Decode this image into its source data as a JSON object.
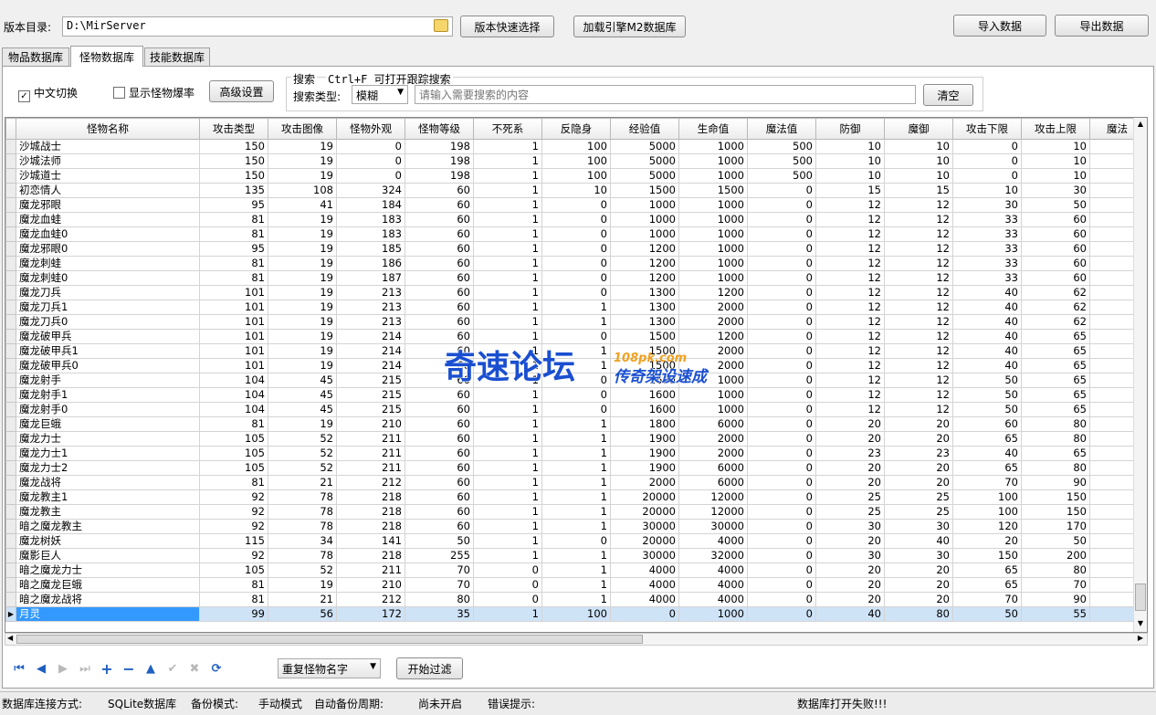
{
  "toolbar": {
    "dir_label": "版本目录:",
    "dir_value": "D:\\MirServer",
    "quick_select": "版本快速选择",
    "load_db": "加载引擎M2数据库",
    "import": "导入数据",
    "export": "导出数据"
  },
  "tabs": [
    "物品数据库",
    "怪物数据库",
    "技能数据库"
  ],
  "options": {
    "chinese_toggle": "中文切换",
    "show_drops": "显示怪物爆率",
    "advanced": "高级设置"
  },
  "search": {
    "title": "搜索",
    "hint": "Ctrl+F 可打开跟踪搜索",
    "type_label": "搜索类型:",
    "type_value": "模糊",
    "placeholder": "请输入需要搜索的内容",
    "clear": "清空"
  },
  "grid": {
    "columns": [
      "怪物名称",
      "攻击类型",
      "攻击图像",
      "怪物外观",
      "怪物等级",
      "不死系",
      "反隐身",
      "经验值",
      "生命值",
      "魔法值",
      "防御",
      "魔御",
      "攻击下限",
      "攻击上限",
      "魔法"
    ],
    "rows": [
      [
        "沙城战士",
        "150",
        "19",
        "0",
        "198",
        "1",
        "100",
        "5000",
        "1000",
        "500",
        "10",
        "10",
        "0",
        "10"
      ],
      [
        "沙城法师",
        "150",
        "19",
        "0",
        "198",
        "1",
        "100",
        "5000",
        "1000",
        "500",
        "10",
        "10",
        "0",
        "10"
      ],
      [
        "沙城道士",
        "150",
        "19",
        "0",
        "198",
        "1",
        "100",
        "5000",
        "1000",
        "500",
        "10",
        "10",
        "0",
        "10"
      ],
      [
        "初恋情人",
        "135",
        "108",
        "324",
        "60",
        "1",
        "10",
        "1500",
        "1500",
        "0",
        "15",
        "15",
        "10",
        "30"
      ],
      [
        "魔龙邪眼",
        "95",
        "41",
        "184",
        "60",
        "1",
        "0",
        "1000",
        "1000",
        "0",
        "12",
        "12",
        "30",
        "50"
      ],
      [
        "魔龙血蛙",
        "81",
        "19",
        "183",
        "60",
        "1",
        "0",
        "1000",
        "1000",
        "0",
        "12",
        "12",
        "33",
        "60"
      ],
      [
        "魔龙血蛙0",
        "81",
        "19",
        "183",
        "60",
        "1",
        "0",
        "1000",
        "1000",
        "0",
        "12",
        "12",
        "33",
        "60"
      ],
      [
        "魔龙邪眼0",
        "95",
        "19",
        "185",
        "60",
        "1",
        "0",
        "1200",
        "1000",
        "0",
        "12",
        "12",
        "33",
        "60"
      ],
      [
        "魔龙刺蛙",
        "81",
        "19",
        "186",
        "60",
        "1",
        "0",
        "1200",
        "1000",
        "0",
        "12",
        "12",
        "33",
        "60"
      ],
      [
        "魔龙刺蛙0",
        "81",
        "19",
        "187",
        "60",
        "1",
        "0",
        "1200",
        "1000",
        "0",
        "12",
        "12",
        "33",
        "60"
      ],
      [
        "魔龙刀兵",
        "101",
        "19",
        "213",
        "60",
        "1",
        "0",
        "1300",
        "1200",
        "0",
        "12",
        "12",
        "40",
        "62"
      ],
      [
        "魔龙刀兵1",
        "101",
        "19",
        "213",
        "60",
        "1",
        "1",
        "1300",
        "2000",
        "0",
        "12",
        "12",
        "40",
        "62"
      ],
      [
        "魔龙刀兵0",
        "101",
        "19",
        "213",
        "60",
        "1",
        "1",
        "1300",
        "2000",
        "0",
        "12",
        "12",
        "40",
        "62"
      ],
      [
        "魔龙破甲兵",
        "101",
        "19",
        "214",
        "60",
        "1",
        "0",
        "1500",
        "1200",
        "0",
        "12",
        "12",
        "40",
        "65"
      ],
      [
        "魔龙破甲兵1",
        "101",
        "19",
        "214",
        "60",
        "1",
        "1",
        "1500",
        "2000",
        "0",
        "12",
        "12",
        "40",
        "65"
      ],
      [
        "魔龙破甲兵0",
        "101",
        "19",
        "214",
        "60",
        "1",
        "1",
        "1500",
        "2000",
        "0",
        "12",
        "12",
        "40",
        "65"
      ],
      [
        "魔龙射手",
        "104",
        "45",
        "215",
        "60",
        "1",
        "0",
        "1600",
        "1000",
        "0",
        "12",
        "12",
        "50",
        "65"
      ],
      [
        "魔龙射手1",
        "104",
        "45",
        "215",
        "60",
        "1",
        "0",
        "1600",
        "1000",
        "0",
        "12",
        "12",
        "50",
        "65"
      ],
      [
        "魔龙射手0",
        "104",
        "45",
        "215",
        "60",
        "1",
        "0",
        "1600",
        "1000",
        "0",
        "12",
        "12",
        "50",
        "65"
      ],
      [
        "魔龙巨蛾",
        "81",
        "19",
        "210",
        "60",
        "1",
        "1",
        "1800",
        "6000",
        "0",
        "20",
        "20",
        "60",
        "80"
      ],
      [
        "魔龙力士",
        "105",
        "52",
        "211",
        "60",
        "1",
        "1",
        "1900",
        "2000",
        "0",
        "20",
        "20",
        "65",
        "80"
      ],
      [
        "魔龙力士1",
        "105",
        "52",
        "211",
        "60",
        "1",
        "1",
        "1900",
        "2000",
        "0",
        "23",
        "23",
        "40",
        "65"
      ],
      [
        "魔龙力士2",
        "105",
        "52",
        "211",
        "60",
        "1",
        "1",
        "1900",
        "6000",
        "0",
        "20",
        "20",
        "65",
        "80"
      ],
      [
        "魔龙战将",
        "81",
        "21",
        "212",
        "60",
        "1",
        "1",
        "2000",
        "6000",
        "0",
        "20",
        "20",
        "70",
        "90"
      ],
      [
        "魔龙教主1",
        "92",
        "78",
        "218",
        "60",
        "1",
        "1",
        "20000",
        "12000",
        "0",
        "25",
        "25",
        "100",
        "150"
      ],
      [
        "魔龙教主",
        "92",
        "78",
        "218",
        "60",
        "1",
        "1",
        "20000",
        "12000",
        "0",
        "25",
        "25",
        "100",
        "150"
      ],
      [
        "暗之魔龙教主",
        "92",
        "78",
        "218",
        "60",
        "1",
        "1",
        "30000",
        "30000",
        "0",
        "30",
        "30",
        "120",
        "170"
      ],
      [
        "魔龙树妖",
        "115",
        "34",
        "141",
        "50",
        "1",
        "0",
        "20000",
        "4000",
        "0",
        "20",
        "40",
        "20",
        "50"
      ],
      [
        "魔影巨人",
        "92",
        "78",
        "218",
        "255",
        "1",
        "1",
        "30000",
        "32000",
        "0",
        "30",
        "30",
        "150",
        "200"
      ],
      [
        "暗之魔龙力士",
        "105",
        "52",
        "211",
        "70",
        "0",
        "1",
        "4000",
        "4000",
        "0",
        "20",
        "20",
        "65",
        "80"
      ],
      [
        "暗之魔龙巨蛾",
        "81",
        "19",
        "210",
        "70",
        "0",
        "1",
        "4000",
        "4000",
        "0",
        "20",
        "20",
        "65",
        "70"
      ],
      [
        "暗之魔龙战将",
        "81",
        "21",
        "212",
        "80",
        "0",
        "1",
        "4000",
        "4000",
        "0",
        "20",
        "20",
        "70",
        "90"
      ],
      [
        "月灵",
        "99",
        "56",
        "172",
        "35",
        "1",
        "100",
        "0",
        "1000",
        "0",
        "40",
        "80",
        "50",
        "55"
      ]
    ],
    "selected_index": 32
  },
  "filter": {
    "dropdown_value": "重复怪物名字",
    "start": "开始过滤"
  },
  "watermark": {
    "main": "奇速论坛",
    "domain": "108pk.com",
    "slogan": "传奇架设速成"
  },
  "status": {
    "conn_label": "数据库连接方式:",
    "conn_value": "SQLite数据库",
    "backup_label": "备份模式:",
    "backup_value": "手动模式",
    "auto_label": "自动备份周期:",
    "auto_value": "尚未开启",
    "error_label": "错误提示:",
    "error_value": "数据库打开失败!!!"
  },
  "colors": {
    "selection": "#3399ff",
    "selection_row": "#cfe3f7",
    "nav_icon": "#1f5fbf",
    "watermark_blue": "#1a4fd0"
  }
}
